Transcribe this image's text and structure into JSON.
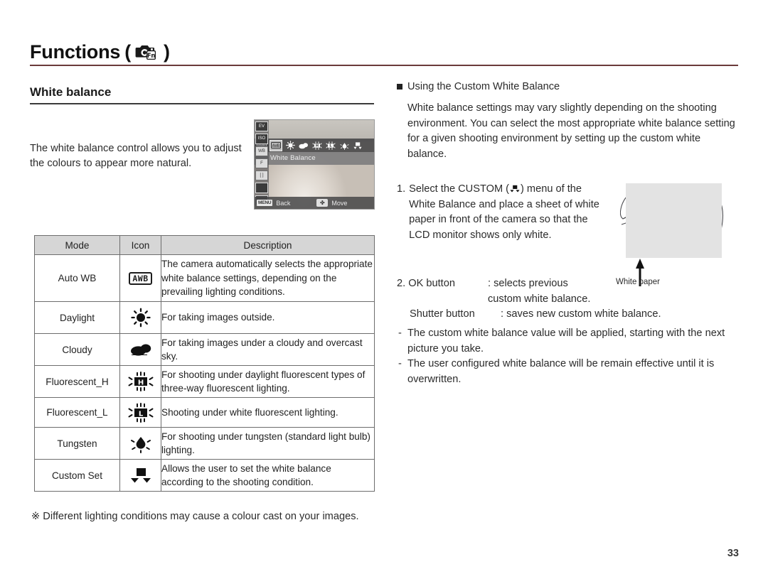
{
  "header": {
    "title": "Functions",
    "paren_open": "(",
    "paren_close": ")",
    "icon": "camera-fn-icon"
  },
  "left": {
    "section_title": "White balance",
    "intro": "The white balance control allows you to adjust the colours to appear more natural.",
    "lcd": {
      "menu_label": "White Balance",
      "back_badge": "MENU",
      "back_text": "Back",
      "move_badge": "✤",
      "move_text": "Move",
      "icons": [
        "awb-icon",
        "daylight-icon",
        "cloudy-icon",
        "fluorescent-h-icon",
        "fluorescent-l-icon",
        "tungsten-icon",
        "custom-set-icon"
      ]
    },
    "table": {
      "headers": [
        "Mode",
        "Icon",
        "Description"
      ],
      "rows": [
        {
          "mode": "Auto WB",
          "icon": "awb-icon",
          "icon_text": "AWB",
          "description": "The camera automatically selects the appropriate white balance settings, depending on the prevailing lighting conditions."
        },
        {
          "mode": "Daylight",
          "icon": "daylight-sun-icon",
          "icon_text": "",
          "description": "For taking images outside."
        },
        {
          "mode": "Cloudy",
          "icon": "cloud-icon",
          "icon_text": "",
          "description": "For taking images under a cloudy and overcast sky."
        },
        {
          "mode": "Fluorescent_H",
          "icon": "fluorescent-h-icon",
          "icon_text": "H",
          "description": "For shooting under daylight fluorescent types of three-way fluorescent lighting."
        },
        {
          "mode": "Fluorescent_L",
          "icon": "fluorescent-l-icon",
          "icon_text": "L",
          "description": "Shooting under white fluorescent lighting."
        },
        {
          "mode": "Tungsten",
          "icon": "tungsten-bulb-icon",
          "icon_text": "",
          "description": "For shooting under tungsten (standard light bulb) lighting."
        },
        {
          "mode": "Custom Set",
          "icon": "custom-set-icon",
          "icon_text": "",
          "description": "Allows the user to set the white balance according to the shooting condition."
        }
      ]
    },
    "note": "※ Different lighting conditions may cause a colour cast on your images."
  },
  "right": {
    "bullet_title": "Using the Custom White Balance",
    "paragraph": "White balance settings may vary slightly depending on the shooting environment. You can select the most appropriate white balance setting for a given shooting environment by setting up the custom white balance.",
    "step1_num": "1.",
    "step1_pre": "Select the CUSTOM (",
    "step1_post": ") menu of the White Balance and place a sheet of white paper in front of the camera so that the LCD monitor shows only white.",
    "step2_num": "2.",
    "step2_rows": [
      {
        "key": "OK button",
        "sep": ":",
        "value": "selects previous"
      },
      {
        "key": "",
        "sep": "",
        "value": "custom white balance."
      },
      {
        "key": "Shutter button",
        "sep": ":",
        "value": "saves new custom white balance."
      }
    ],
    "dashes": [
      "The custom white balance value will be applied, starting with the next picture you take.",
      "The user configured white balance will be remain effective until it is overwritten."
    ],
    "dash_mark": "-",
    "white_paper_label": "White paper"
  },
  "footer": {
    "page_number": "33"
  },
  "colors": {
    "header_rule": "#6b3a3a",
    "section_rule": "#3b3b3b",
    "table_header_bg": "#d6d6d6",
    "table_border": "#6d6d6d",
    "text": "#2b2b2b"
  }
}
